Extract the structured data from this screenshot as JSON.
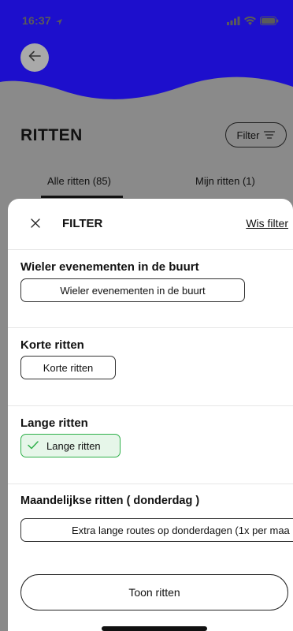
{
  "status_bar": {
    "time": "16:37"
  },
  "colors": {
    "header_blue": "#1d0fcc",
    "overlay_gray": "#8a8a8a",
    "selected_green": "#2fb04a",
    "selected_bg": "#e6f6e9"
  },
  "page": {
    "title": "RITTEN",
    "filter_button": "Filter",
    "tabs": [
      {
        "label": "Alle ritten (85)",
        "active": true
      },
      {
        "label": "Mijn ritten (1)",
        "active": false
      }
    ]
  },
  "filter_sheet": {
    "title": "FILTER",
    "clear_label": "Wis filter",
    "sections": [
      {
        "title": "Wieler evenementen in de buurt",
        "chip": "Wieler evenementen in de buurt",
        "selected": false
      },
      {
        "title": "Korte ritten",
        "chip": "Korte ritten",
        "selected": false
      },
      {
        "title": "Lange ritten",
        "chip": "Lange ritten",
        "selected": true
      },
      {
        "title": "Maandelijkse ritten ( donderdag )",
        "chip": "Extra lange routes op donderdagen (1x per maa",
        "selected": false
      }
    ],
    "submit_label": "Toon ritten"
  }
}
